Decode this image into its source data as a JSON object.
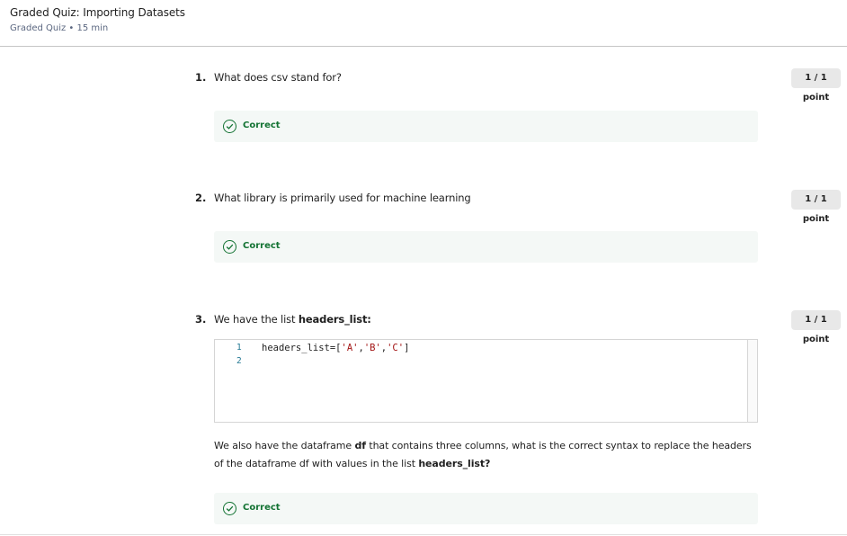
{
  "header": {
    "title": "Graded Quiz: Importing Datasets",
    "subtitle": "Graded Quiz • 15 min"
  },
  "questions": [
    {
      "number": "1.",
      "text": "What does csv stand for?",
      "points": "1 / 1 point",
      "result": "Correct"
    },
    {
      "number": "2.",
      "text": "What library is primarily used for machine learning",
      "points": "1 / 1 point",
      "result": "Correct"
    },
    {
      "number": "3.",
      "text_prefix": "We have the list ",
      "text_bold": "headers_list:",
      "points": "1 / 1 point",
      "code": {
        "line_numbers": [
          "1",
          "2"
        ],
        "line1_code": "headers_list=[",
        "line1_str1": "'A'",
        "line1_comma1": ",",
        "line1_str2": "'B'",
        "line1_comma2": ",",
        "line1_str3": "'C'",
        "line1_end": "]"
      },
      "para_1": "We also have the dataframe ",
      "para_bold_1": "df",
      "para_2": " that contains three columns, what is the correct syntax to replace the headers of the dataframe df with values in the list ",
      "para_bold_2": "headers_list?",
      "result": "Correct"
    }
  ],
  "colors": {
    "correct_green": "#137333",
    "correct_bg": "#f4f8f6",
    "points_bg": "#e8e8e8"
  },
  "icons": {
    "correct": "check-circle-icon"
  }
}
